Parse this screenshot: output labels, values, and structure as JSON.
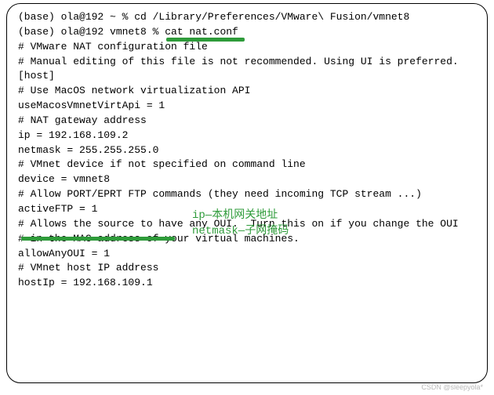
{
  "terminal": {
    "lines": [
      "(base) ola@192 ~ % cd /Library/Preferences/VMware\\ Fusion/vmnet8",
      "(base) ola@192 vmnet8 % cat nat.conf",
      "# VMware NAT configuration file",
      "# Manual editing of this file is not recommended. Using UI is preferred.",
      "",
      "[host]",
      "",
      "# Use MacOS network virtualization API",
      "useMacosVmnetVirtApi = 1",
      "",
      "# NAT gateway address",
      "ip = 192.168.109.2",
      "netmask = 255.255.255.0",
      "",
      "# VMnet device if not specified on command line",
      "device = vmnet8",
      "",
      "# Allow PORT/EPRT FTP commands (they need incoming TCP stream ...)",
      "activeFTP = 1",
      "",
      "# Allows the source to have any OUI.  Turn this on if you change the OUI",
      "# in the MAC address of your virtual machines.",
      "allowAnyOUI = 1",
      "",
      "# VMnet host IP address",
      "hostIp = 192.168.109.1"
    ]
  },
  "annotations": {
    "ip_label": "ip—本机网关地址",
    "netmask_label": "netmask—子网掩码"
  },
  "watermark": "CSDN @sleepyola*"
}
